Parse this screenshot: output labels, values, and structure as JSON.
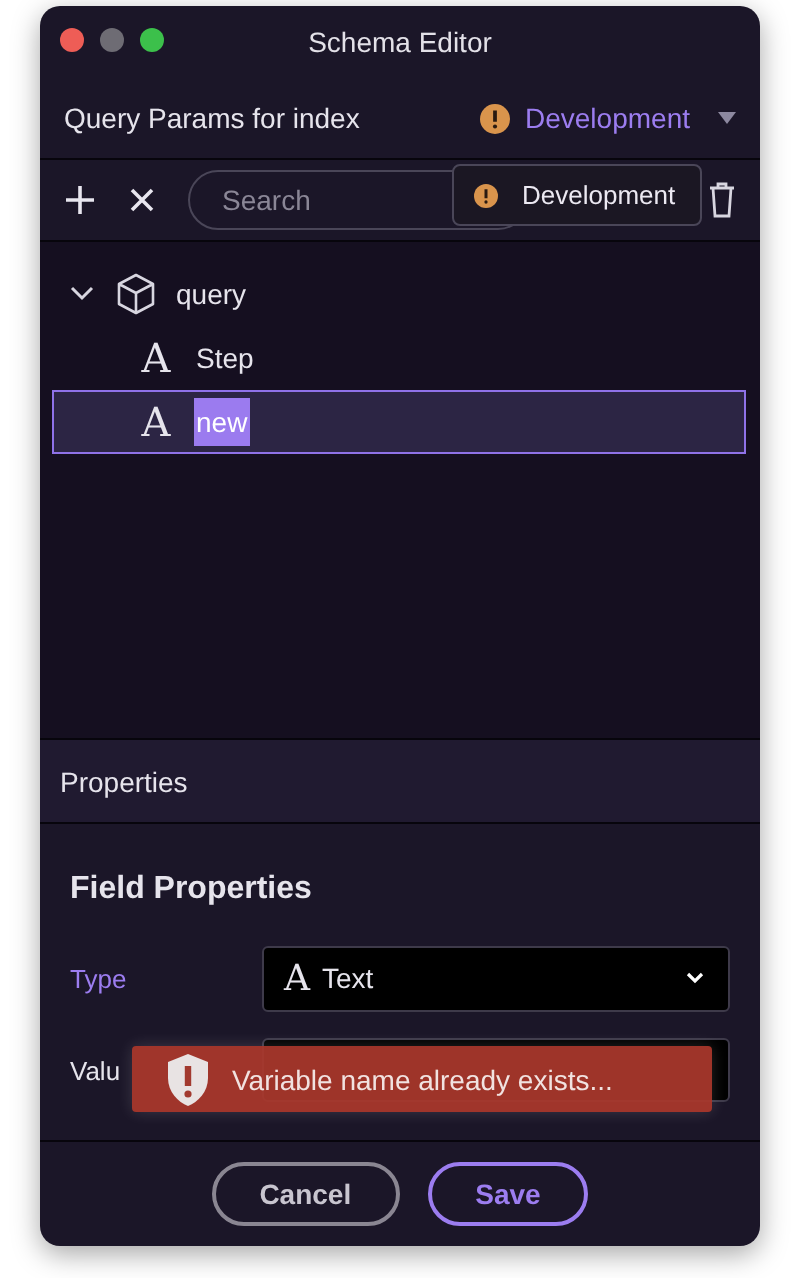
{
  "window": {
    "title": "Schema Editor"
  },
  "header": {
    "title": "Query Params for index",
    "environment": "Development"
  },
  "toolbar": {
    "search_placeholder": "Search"
  },
  "tooltip": {
    "text": "Development"
  },
  "tree": [
    {
      "label": "query",
      "kind": "object",
      "expanded": true,
      "selected": false,
      "children": [
        {
          "label": "Step",
          "kind": "text",
          "icon": "A",
          "selected": false,
          "editing": false
        },
        {
          "label": "new",
          "kind": "text",
          "icon": "A",
          "selected": true,
          "editing": true
        }
      ]
    }
  ],
  "properties": {
    "title": "Properties",
    "heading": "Field Properties",
    "fields": [
      {
        "label": "Type",
        "kind": "select",
        "icon": "A",
        "value": "Text",
        "active": true
      },
      {
        "label": "Valu",
        "kind": "input",
        "active": false
      }
    ]
  },
  "toast": {
    "message": "Variable name already exists..."
  },
  "buttons": [
    {
      "label": "Cancel",
      "kind": "secondary"
    },
    {
      "label": "Save",
      "kind": "primary"
    }
  ]
}
